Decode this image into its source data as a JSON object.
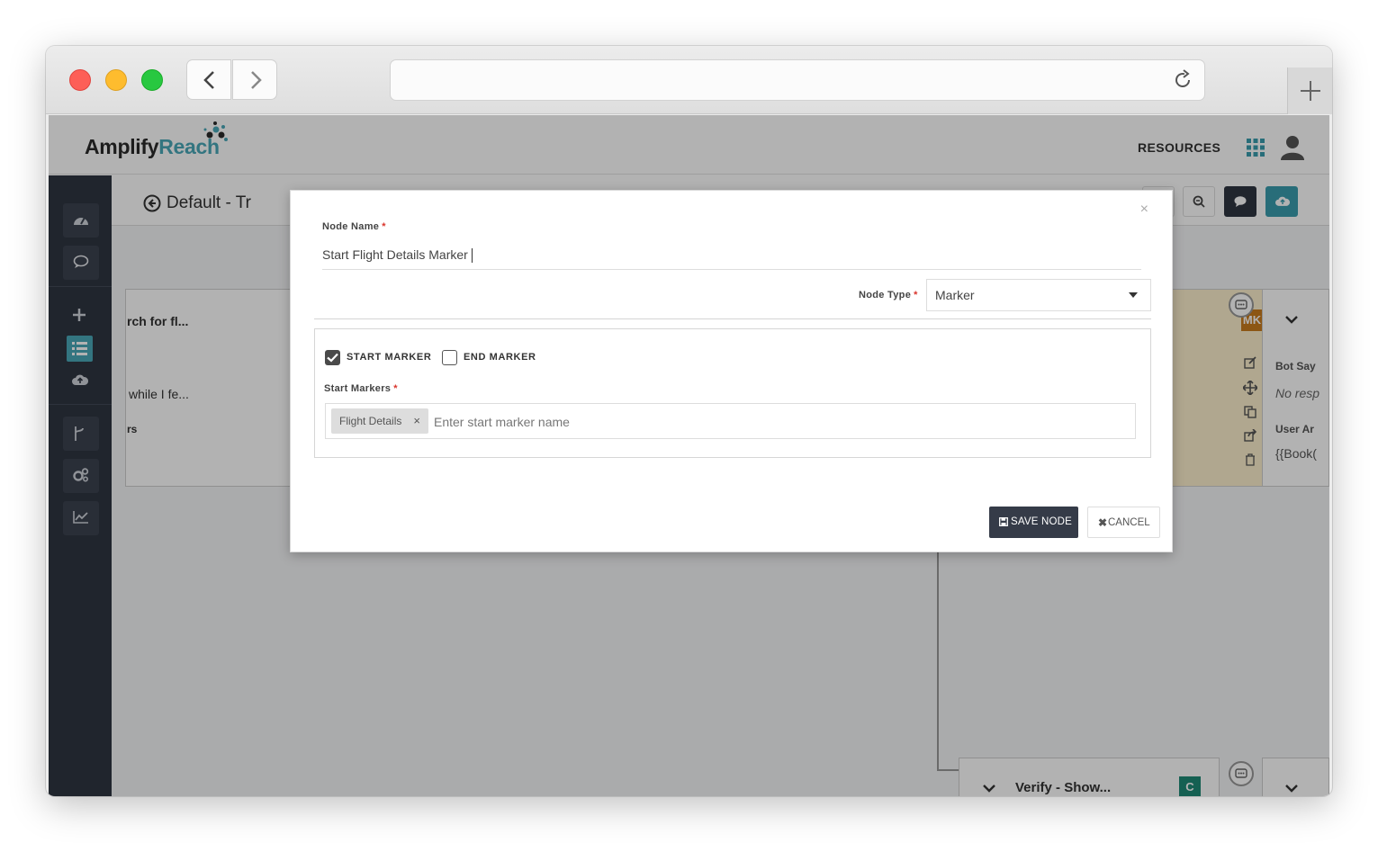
{
  "browser": {
    "url": ""
  },
  "header": {
    "logo_main": "Amplify",
    "logo_accent": "Reach",
    "resources": "RESOURCES"
  },
  "canvas": {
    "title": "Default - Tr",
    "node1_title": "rch for fl...",
    "node1_line": "while I fe...",
    "node1_line2": "rs",
    "node2_badge": "MK",
    "node3_label1": "Bot Say",
    "node3_text1": "No resp",
    "node3_label2": "User Ar",
    "node3_text2": "{{Book(",
    "node4_title": "Verify - Show...",
    "node4_badge": "C"
  },
  "modal": {
    "close": "×",
    "node_name_label": "Node Name",
    "node_name_value": "Start Flight Details Marker",
    "node_type_label": "Node Type",
    "node_type_value": "Marker",
    "start_marker_label": "START MARKER",
    "end_marker_label": "END MARKER",
    "start_marker_checked": true,
    "end_marker_checked": false,
    "start_markers_label": "Start Markers",
    "tags": [
      "Flight Details"
    ],
    "tags_placeholder": "Enter start marker name",
    "save_label": "SAVE NODE",
    "cancel_label": "CANCEL",
    "required_mark": "*"
  }
}
